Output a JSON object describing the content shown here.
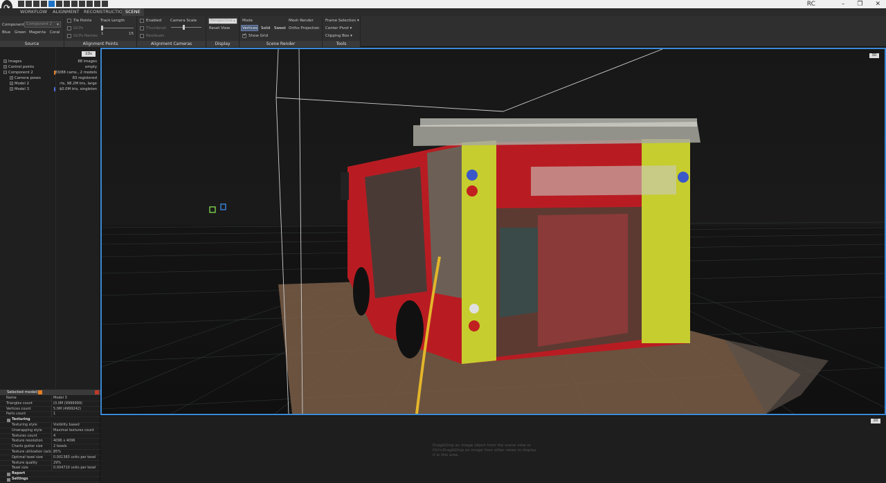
{
  "tabs": [
    "WORKFLOW",
    "ALIGNMENT",
    "RECONSTRUCTION",
    "SCENE"
  ],
  "active_tab": "SCENE",
  "user_badge": "RC",
  "window_controls": [
    "–",
    "❐",
    "✕"
  ],
  "source": {
    "component_label": "Component",
    "component_value": "Component 2",
    "colors": [
      "Blue",
      "Green",
      "Magenta",
      "Coral"
    ],
    "group_label": "Source"
  },
  "alignment_points": {
    "tie_points": "Tie Points",
    "gcps": "GCPs",
    "gcps_names": "GCPs Names",
    "track_length": "Track Length",
    "slider_min": "1",
    "slider_max": "15",
    "group_label": "Alignment Points"
  },
  "alignment_cameras": {
    "enabled": "Enabled",
    "thumbnail": "Thumbnail",
    "residuals": "Residuals",
    "camera_scale": "Camera Scale",
    "group_label": "Alignment Cameras"
  },
  "display": {
    "projection": "Perspective",
    "reset_view": "Reset View",
    "group_label": "Display"
  },
  "scene_render": {
    "mode_label": "Mode",
    "modes": [
      "Vertices",
      "Solid",
      "Sweet"
    ],
    "show_grid": "Show Grid",
    "mesh_render": "Mesh Render",
    "ortho_projection": "Ortho Projection",
    "group_label": "Scene Render"
  },
  "tools": {
    "items": [
      "Frame Selection",
      "Center Pivot",
      "Clipping Box"
    ],
    "group_label": "Tools"
  },
  "tree": {
    "header_button": "1Ds",
    "rows": [
      {
        "name": "Images",
        "value": "88 images"
      },
      {
        "name": "Control points",
        "value": "empty"
      },
      {
        "name": "Component 2",
        "value": "83/88 cams., 2 models"
      },
      {
        "name": "Camera poses",
        "value": "83 registered"
      },
      {
        "name": "Model 2",
        "value": "rts, 98.2M tris, large"
      },
      {
        "name": "Model 3",
        "value": " $0.0M tris, singleton"
      }
    ]
  },
  "selected_models": {
    "title": "Selected model(s)",
    "rows": [
      {
        "k": "Name",
        "v": "Model 3"
      },
      {
        "k": "Triangles count",
        "v": "(0.0M (9999999)"
      },
      {
        "k": "Vertices count",
        "v": "5.0M (4999242)"
      },
      {
        "k": "Parts count",
        "v": "1"
      }
    ],
    "texturing_section": "Texturing",
    "texturing_rows": [
      {
        "k": "Texturing style",
        "v": "Visibility based"
      },
      {
        "k": "Unwrapping style",
        "v": "Maximal textures count"
      },
      {
        "k": "Textures count",
        "v": "4"
      },
      {
        "k": "Texture resolution",
        "v": "4096 x 4096"
      },
      {
        "k": "Charts gutter size",
        "v": "2 texels"
      },
      {
        "k": "Texture utilization (w/o...",
        "v": "85%"
      },
      {
        "k": "Optimal texel size",
        "v": "0.001383 units per texel"
      },
      {
        "k": "Texture quality",
        "v": "29%"
      },
      {
        "k": "Texel size",
        "v": "0.004710 units per texel"
      }
    ],
    "report_section": "Report",
    "settings_section": "Settings"
  },
  "viewport3d": {
    "tag": "3D"
  },
  "viewport2d": {
    "tag": "2D",
    "hint": "Drag&Drop an image object from the scene view or Ctrl+Drag&Drop an image from other views to display it in this area."
  },
  "colors": {
    "accent": "#3c8ad8",
    "truck_red": "#b81c22",
    "truck_yellow": "#d9e23a"
  }
}
